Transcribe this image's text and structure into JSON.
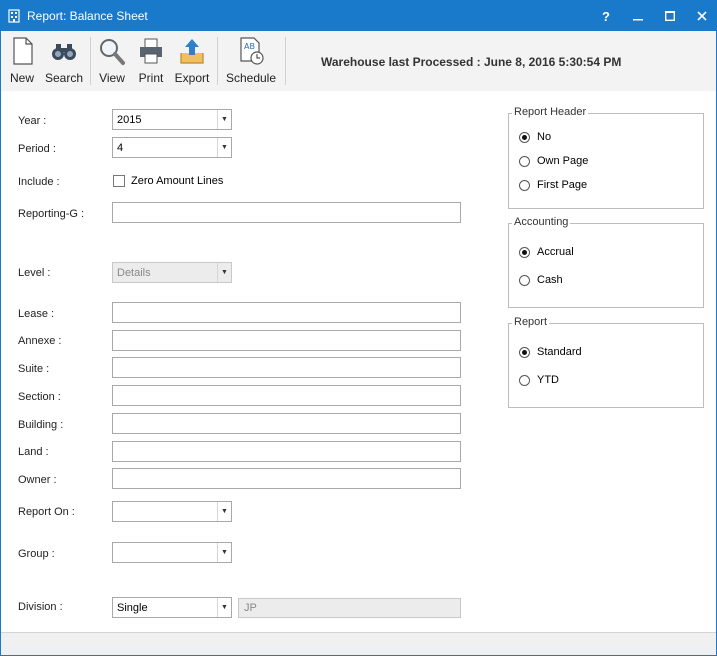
{
  "window": {
    "title": "Report: Balance Sheet",
    "help_label": "?",
    "accent": "#1979ca"
  },
  "toolbar": {
    "new_label": "New",
    "search_label": "Search",
    "view_label": "View",
    "print_label": "Print",
    "export_label": "Export",
    "schedule_label": "Schedule"
  },
  "warehouse_text": "Warehouse last Processed : June 8, 2016 5:30:54 PM",
  "form": {
    "year_label": "Year :",
    "year_value": "2015",
    "period_label": "Period :",
    "period_value": "4",
    "include_label": "Include :",
    "zero_amount_label": "Zero Amount Lines",
    "zero_amount_checked": false,
    "reporting_g_label": "Reporting-G :",
    "level_label": "Level :",
    "level_value": "Details",
    "lease_label": "Lease :",
    "annexe_label": "Annexe :",
    "suite_label": "Suite :",
    "section_label": "Section :",
    "building_label": "Building :",
    "land_label": "Land :",
    "owner_label": "Owner :",
    "report_on_label": "Report On :",
    "group_label": "Group :",
    "division_label": "Division :",
    "division_value": "Single",
    "division_code": "JP"
  },
  "report_header": {
    "title": "Report Header",
    "options": [
      "No",
      "Own Page",
      "First Page"
    ],
    "selected": "No"
  },
  "accounting": {
    "title": "Accounting",
    "options": [
      "Accrual",
      "Cash"
    ],
    "selected": "Accrual"
  },
  "report": {
    "title": "Report",
    "options": [
      "Standard",
      "YTD"
    ],
    "selected": "Standard"
  }
}
